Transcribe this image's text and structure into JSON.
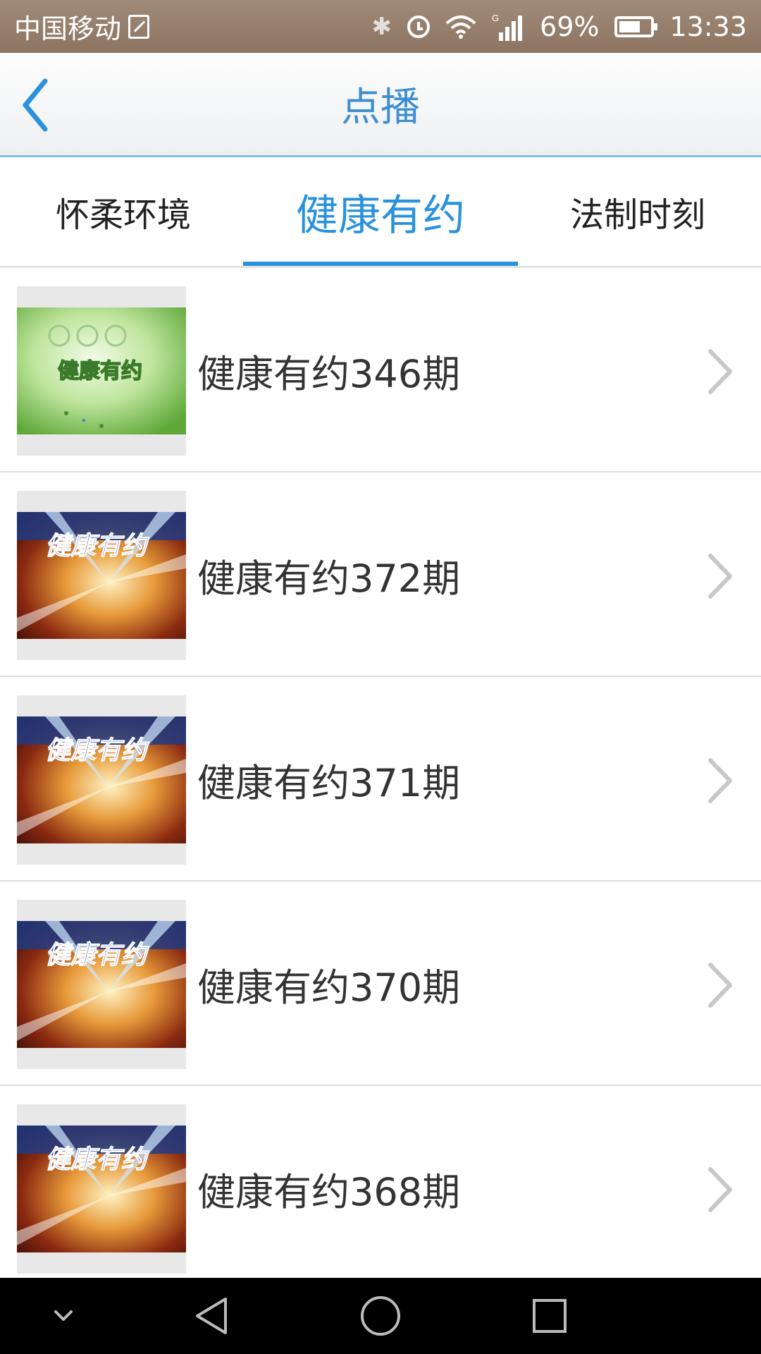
{
  "status_bar": {
    "carrier": "中国移动",
    "network_type": "G",
    "battery_level": 0.69,
    "battery_text": "69%",
    "time": "13:33"
  },
  "header": {
    "title": "点播",
    "back_icon": "back-arrow-icon",
    "accent_color": "#2a92dd"
  },
  "tabs": [
    {
      "label": "怀柔环境",
      "active": false
    },
    {
      "label": "健康有约",
      "active": true
    },
    {
      "label": "法制时刻",
      "active": false
    }
  ],
  "items": [
    {
      "title": "健康有约346期",
      "thumb_style": "green"
    },
    {
      "title": "健康有约372期",
      "thumb_style": "gold"
    },
    {
      "title": "健康有约371期",
      "thumb_style": "gold"
    },
    {
      "title": "健康有约370期",
      "thumb_style": "gold"
    },
    {
      "title": "健康有约368期",
      "thumb_style": "gold"
    }
  ],
  "thumbnail_caption": "健康有约",
  "nav_bar": {
    "icons": [
      "collapse-icon",
      "back-triangle-icon",
      "home-circle-icon",
      "recents-square-icon"
    ]
  }
}
